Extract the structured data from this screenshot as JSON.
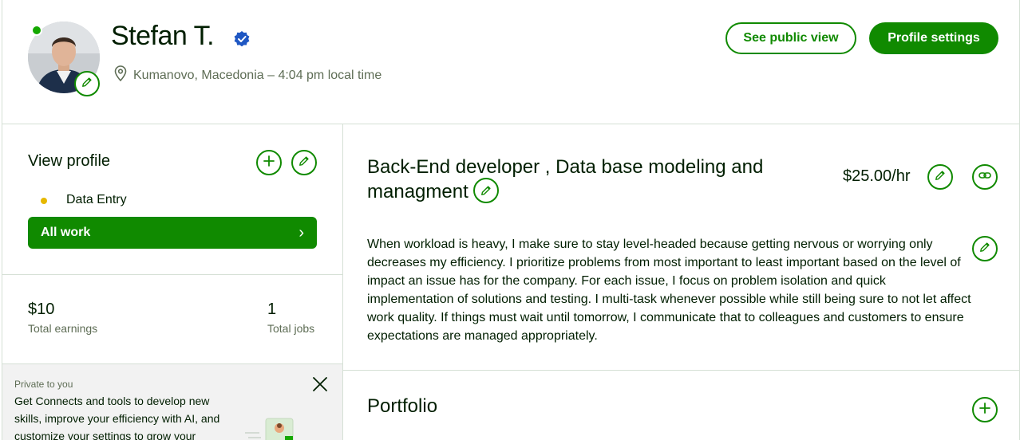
{
  "profile": {
    "name": "Stefan T.",
    "location": "Kumanovo, Macedonia – 4:04 pm local time"
  },
  "header": {
    "public_view_label": "See public view",
    "settings_label": "Profile settings"
  },
  "sidebar": {
    "view_profile_title": "View profile",
    "specialized_item": "Data Entry",
    "all_work_label": "All work",
    "all_work_chevron": "›",
    "stats": [
      {
        "value": "$10",
        "label": "Total earnings"
      },
      {
        "value": "1",
        "label": "Total jobs"
      }
    ],
    "promo": {
      "private_label": "Private to you",
      "text": "Get Connects and tools to develop new skills, improve your efficiency with AI, and customize your settings to grow your"
    }
  },
  "main": {
    "title": "Back-End developer , Data base modeling and managment",
    "rate": "$25.00/hr",
    "overview": "When workload is heavy, I make sure to stay level-headed because getting nervous or worrying only decreases my efficiency. I prioritize problems from most important to least important based on the level of impact an issue has for the company. For each issue, I focus on problem isolation and quick implementation of solutions and testing. I multi-task whenever possible while still being sure to not let affect work quality. If things must wait until tomorrow, I communicate that to colleagues and customers to ensure expectations are managed appropriately.",
    "portfolio_title": "Portfolio"
  },
  "colors": {
    "brand_green": "#108a00",
    "online_green": "#14a800",
    "verified_blue": "#1f57c3",
    "muted_text": "#5e6d55",
    "divider": "#d5e0d5",
    "bullet_yellow": "#e6b800"
  },
  "icons": [
    "pencil-icon",
    "plus-icon",
    "link-icon",
    "location-pin-icon",
    "verified-badge-icon",
    "close-icon",
    "chevron-right-icon"
  ]
}
